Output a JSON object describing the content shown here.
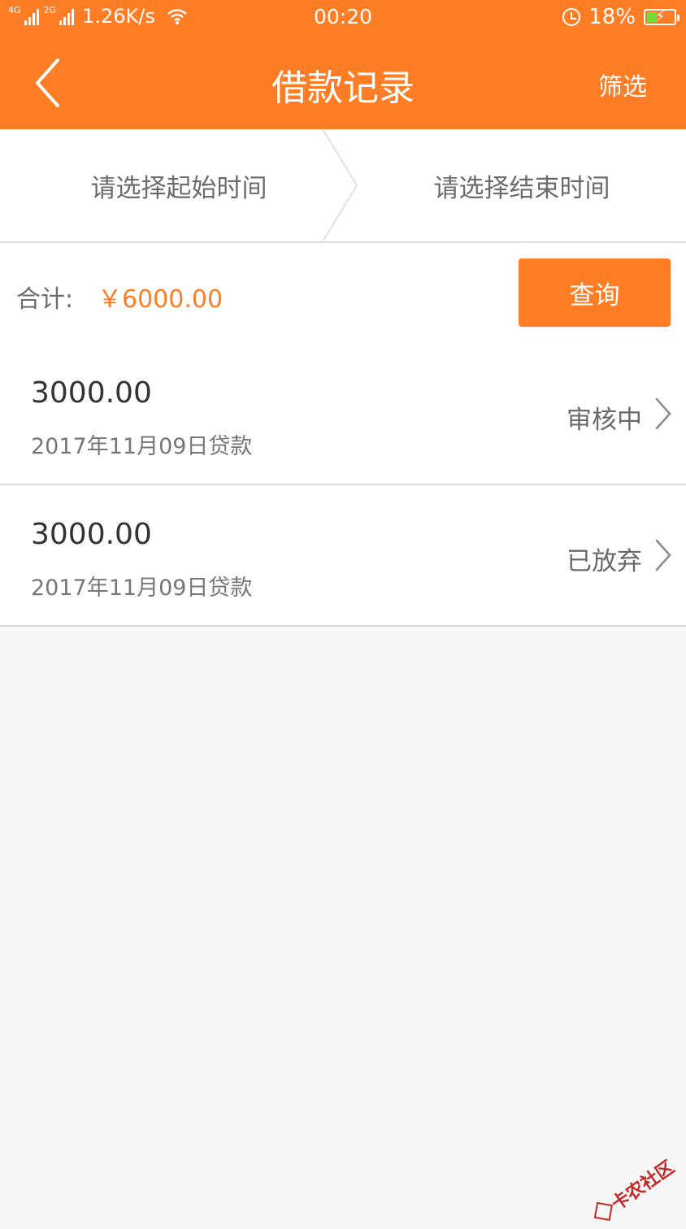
{
  "status_bar": {
    "network_4g": "4G",
    "network_2g": "2G",
    "speed": "1.26K/s",
    "time": "00:20",
    "battery": "18%"
  },
  "nav": {
    "title": "借款记录",
    "filter_label": "筛选"
  },
  "date_range": {
    "start_placeholder": "请选择起始时间",
    "end_placeholder": "请选择结束时间"
  },
  "summary": {
    "total_label": "合计:",
    "total_value": "￥6000.00",
    "query_label": "查询"
  },
  "records": [
    {
      "amount": "3000.00",
      "date": "2017年11月09日贷款",
      "status": "审核中"
    },
    {
      "amount": "3000.00",
      "date": "2017年11月09日贷款",
      "status": "已放弃"
    }
  ],
  "watermark": "卡农社区",
  "colors": {
    "accent": "#ff7d25",
    "background": "#f7f7f7",
    "battery_fill": "#6fde3b"
  }
}
